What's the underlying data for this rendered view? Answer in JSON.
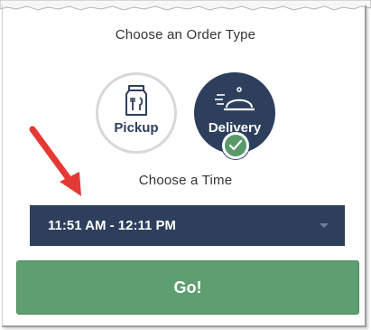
{
  "order_type": {
    "title": "Choose an Order Type",
    "options": [
      {
        "label": "Pickup",
        "icon": "takeout-bag-icon",
        "selected": false
      },
      {
        "label": "Delivery",
        "icon": "serving-cloche-icon",
        "selected": true
      }
    ]
  },
  "time": {
    "title": "Choose a Time",
    "selected_value": "11:51 AM - 12:11 PM"
  },
  "actions": {
    "go_label": "Go!"
  },
  "colors": {
    "navy": "#2d3f5c",
    "green": "#5f9e71",
    "annotation_arrow": "#e53935"
  }
}
